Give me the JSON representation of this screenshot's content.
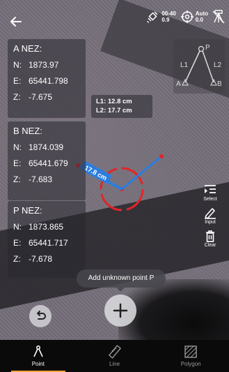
{
  "top_bar": {
    "status_satellite": {
      "icon": "satellite-icon",
      "top": "00-40",
      "bottom": "0.9"
    },
    "status_target": {
      "icon": "crosshair-icon",
      "top": "Auto",
      "bottom": "0.0"
    },
    "status_tripod": {
      "icon": "tripod-off-icon"
    }
  },
  "points": [
    {
      "title": "A NEZ:",
      "n_key": "N:",
      "n": "1873.97",
      "e_key": "E:",
      "e": "65441.798",
      "z_key": "Z:",
      "z": "-7.675"
    },
    {
      "title": "B NEZ:",
      "n_key": "N:",
      "n": "1874.039",
      "e_key": "E:",
      "e": "65441.679",
      "z_key": "Z:",
      "z": "-7.683"
    },
    {
      "title": "P NEZ:",
      "n_key": "N:",
      "n": "1873.865",
      "e_key": "E:",
      "e": "65441.717",
      "z_key": "Z:",
      "z": "-7.678"
    }
  ],
  "lengths": {
    "l1": "L1:  12.8 cm",
    "l2": "L2:  17.7 cm"
  },
  "measurement_label": "17.8 cm",
  "diagram": {
    "p": "P",
    "a": "A",
    "b": "B",
    "l1": "L1",
    "l2": "L2"
  },
  "tools": {
    "select": "Select",
    "input": "Input",
    "clear": "Clear"
  },
  "tooltip": "Add unknown point P",
  "nav": [
    {
      "label": "Point",
      "active": true
    },
    {
      "label": "Line",
      "active": false
    },
    {
      "label": "Polygon",
      "active": false
    }
  ],
  "colors": {
    "accent": "#f3a53a",
    "measure_line": "#2b7de0",
    "target": "#e0262a"
  }
}
